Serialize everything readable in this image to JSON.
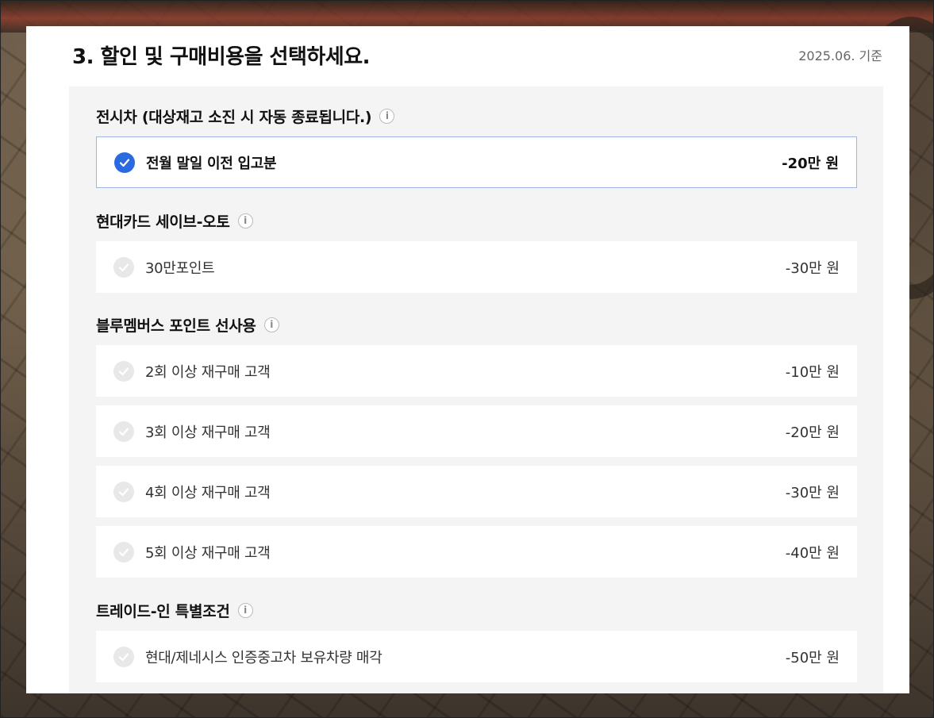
{
  "header": {
    "title": "3. 할인 및 구매비용을 선택하세요.",
    "date": "2025.06. 기준"
  },
  "groups": [
    {
      "title": "전시차 (대상재고 소진 시 자동 종료됩니다.)",
      "options": [
        {
          "label": "전월 말일 이전 입고분",
          "price": "-20만 원",
          "selected": true
        }
      ]
    },
    {
      "title": "현대카드 세이브-오토",
      "options": [
        {
          "label": "30만포인트",
          "price": "-30만 원",
          "selected": false
        }
      ]
    },
    {
      "title": "블루멤버스 포인트 선사용",
      "options": [
        {
          "label": "2회 이상 재구매 고객",
          "price": "-10만 원",
          "selected": false
        },
        {
          "label": "3회 이상 재구매 고객",
          "price": "-20만 원",
          "selected": false
        },
        {
          "label": "4회 이상 재구매 고객",
          "price": "-30만 원",
          "selected": false
        },
        {
          "label": "5회 이상 재구매 고객",
          "price": "-40만 원",
          "selected": false
        }
      ]
    },
    {
      "title": "트레이드-인 특별조건",
      "options": [
        {
          "label": "현대/제네시스 인증중고차 보유차량 매각",
          "price": "-50만 원",
          "selected": false
        }
      ]
    }
  ],
  "icons": {
    "info": "info-icon",
    "check": "check-icon"
  },
  "colors": {
    "accent": "#2a6ae0",
    "selected_border": "#9db4e6",
    "box_bg": "#f4f4f4"
  }
}
